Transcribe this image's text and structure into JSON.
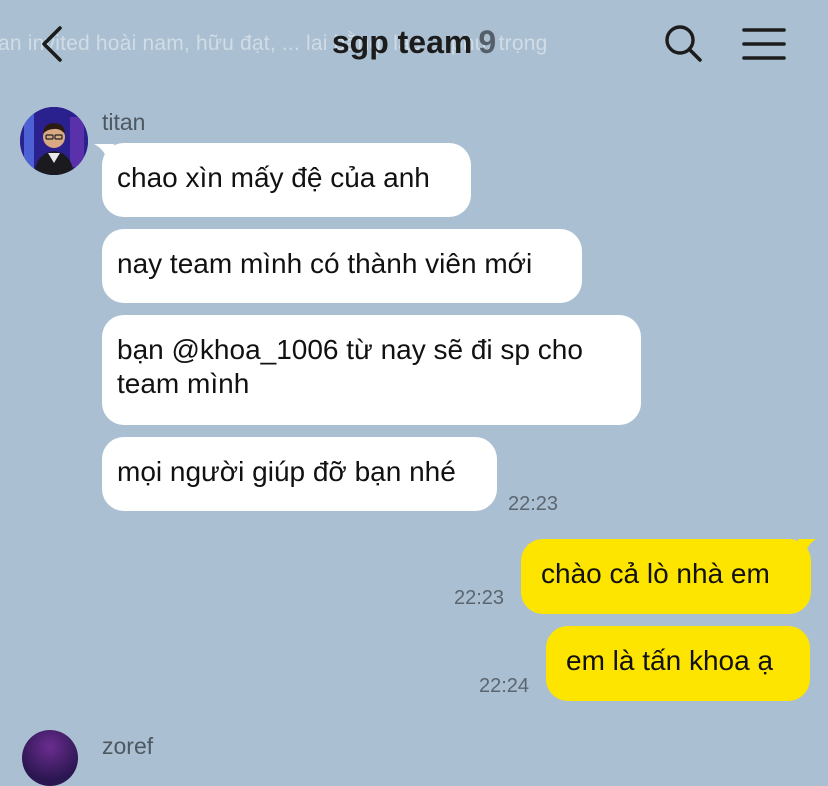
{
  "header": {
    "marquee": "an invited hoài nam, hữu đạt, ... lai bằng, lạc ... phú, trọng",
    "title": "sgp team",
    "member_count": "9",
    "icons": {
      "back": "chevron-left-icon",
      "search": "search-icon",
      "menu": "hamburger-menu-icon"
    }
  },
  "messages": [
    {
      "sender": "titan",
      "text": "chao xìn mấy đệ của anh"
    },
    {
      "text": "nay team mình có thành viên mới"
    },
    {
      "text": "bạn @khoa_1006 từ nay sẽ đi sp cho team mình"
    },
    {
      "text": "mọi người giúp đỡ bạn nhé",
      "time": "22:23"
    },
    {
      "text": "chào cả lò nhà em",
      "time": "22:23",
      "mine": true
    },
    {
      "text": "em là tấn khoa ạ",
      "time": "22:24",
      "mine": true
    }
  ],
  "next_sender": "zoref",
  "colors": {
    "background": "#aabfd1",
    "incoming_bubble": "#ffffff",
    "outgoing_bubble": "#fee500"
  }
}
